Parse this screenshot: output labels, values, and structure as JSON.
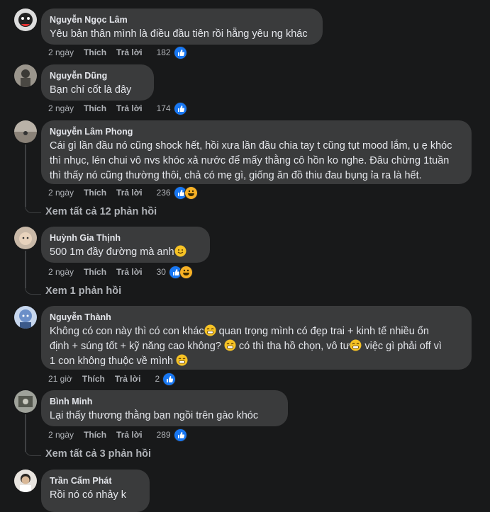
{
  "colors": {
    "background": "#18191a",
    "bubble": "#3a3b3c",
    "like": "#1877f2",
    "haha": "#f7b125"
  },
  "comments": [
    {
      "author": "Nguyễn Ngọc Lâm",
      "lines": [
        "Yêu bản thân mình là điều đầu tiên rồi hẵng yêu ng khác"
      ],
      "time": "2 ngày",
      "like": "Thích",
      "reply": "Trả lời",
      "reactions": "182",
      "react_icons": [
        "like-icon"
      ]
    },
    {
      "author": "Nguyễn Dũng",
      "lines": [
        "Bạn chí cốt là đây"
      ],
      "time": "2 ngày",
      "like": "Thích",
      "reply": "Trả lời",
      "reactions": "174",
      "react_icons": [
        "like-icon"
      ]
    },
    {
      "author": "Nguyễn Lâm Phong",
      "lines": [
        "Cái gì lần đầu nó cũng shock hết, hồi xưa lần đầu chia tay t cũng tụt mood lắm, ụ ẹ khóc",
        "thì nhục, lén chui vô nvs khóc xả nước để mấy thằng cô hồn ko nghe. Đâu chừng 1tuần",
        "thì thấy nó cũng thường thôi, chả có mẹ gì, giống ăn đồ thiu đau bụng ỉa ra là hết."
      ],
      "time": "2 ngày",
      "like": "Thích",
      "reply": "Trả lời",
      "reactions": "236",
      "react_icons": [
        "like-icon",
        "haha-icon"
      ],
      "view_replies": "Xem tất cả 12 phản hồi"
    },
    {
      "author": "Huỳnh Gia Thịnh",
      "lines": [
        "500 1m đầy đường mà anh"
      ],
      "time": "2 ngày",
      "like": "Thích",
      "reply": "Trả lời",
      "reactions": "30",
      "react_icons": [
        "like-icon",
        "haha-icon"
      ],
      "view_replies": "Xem 1 phản hồi"
    },
    {
      "author": "Nguyễn Thành",
      "lines": [
        "Không có con này thì có con khác",
        " quan trọng mình có đẹp trai + kinh tế nhiều ổn",
        "định + súng tốt + kỹ năng cao không?",
        " có thì tha hồ chọn, vô tư",
        " việc gì phải off vì",
        "1 con không thuộc về mình"
      ],
      "time": "21 giờ",
      "like": "Thích",
      "reply": "Trả lời",
      "reactions": "2",
      "react_icons": [
        "like-icon"
      ]
    },
    {
      "author": "Bình Minh",
      "lines": [
        "Lại thấy thương thằng bạn ngồi trên gào khóc"
      ],
      "time": "2 ngày",
      "like": "Thích",
      "reply": "Trả lời",
      "reactions": "289",
      "react_icons": [
        "like-icon"
      ],
      "view_replies": "Xem tất cả 3 phản hồi"
    },
    {
      "author": "Trần Cẩm Phát",
      "lines": [
        "Rồi nó có nhảy k"
      ]
    }
  ]
}
